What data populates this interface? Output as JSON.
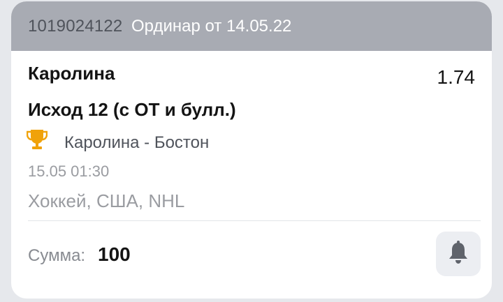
{
  "header": {
    "bet_id": "1019024122",
    "bet_type": "Ординар от 14.05.22"
  },
  "selection": {
    "team": "Каролина",
    "odds": "1.74",
    "outcome": "Исход 12 (с ОТ и булл.)",
    "match": "Каролина - Бостон",
    "datetime": "15.05 01:30",
    "league": "Хоккей, США, NHL"
  },
  "footer": {
    "sum_label": "Сумма:",
    "sum_value": "100"
  },
  "icons": {
    "trophy": "trophy-icon",
    "bell": "bell-icon"
  },
  "colors": {
    "header_bg": "#a8abb3",
    "trophy": "#f0a20a",
    "bell": "#5f636b"
  }
}
